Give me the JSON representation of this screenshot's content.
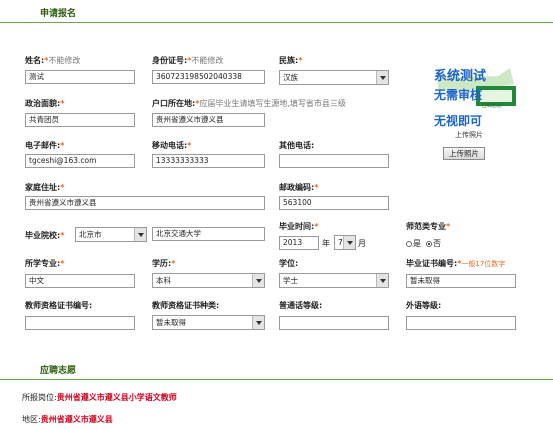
{
  "section1_title": "申请报名",
  "section2_title": "应聘志愿",
  "fields": {
    "name_label": "姓名:",
    "name_note": "不能修改",
    "name_value": "测试",
    "id_label": "身份证号:",
    "id_note": "不能修改",
    "id_value": "360723198502040338",
    "ethnic_label": "民族:",
    "ethnic_value": "汉族",
    "political_label": "政治面貌:",
    "political_value": "共青团员",
    "hukou_label": "户口所在地:",
    "hukou_note": "应届毕业生请填写生源地,填写省市县三级",
    "hukou_value": "贵州省遵义市遵义县",
    "email_label": "电子邮件:",
    "email_value": "tgceshi@163.com",
    "mobile_label": "移动电话:",
    "mobile_value": "13333333333",
    "other_phone_label": "其他电话:",
    "other_phone_value": "",
    "address_label": "家庭住址:",
    "address_value": "贵州省遵义市遵义县",
    "postcode_label": "邮政编码:",
    "postcode_value": "563100",
    "school_label": "毕业院校:",
    "school_city": "北京市",
    "school_value": "北京交通大学",
    "grad_time_label": "毕业时间:",
    "grad_year": "2013",
    "year_unit": "年",
    "grad_month": "7",
    "month_unit": "月",
    "normal_label": "师范类专业",
    "normal_yes": "是",
    "normal_no": "否",
    "major_label": "所学专业:",
    "major_value": "中文",
    "edu_label": "学历:",
    "edu_value": "本科",
    "degree_label": "学位:",
    "degree_value": "学士",
    "cert_no_label": "毕业证书编号:",
    "cert_no_note": "一般17位数字",
    "cert_no_value": "暂未取得",
    "teacher_cert_no_label": "教师资格证书编号:",
    "teacher_cert_no_value": "",
    "teacher_cert_type_label": "教师资格证书种类:",
    "teacher_cert_type_value": "暂未取得",
    "mandarin_label": "普通话等级:",
    "mandarin_value": "",
    "foreign_label": "外语等级:",
    "foreign_value": ""
  },
  "photo": {
    "line1": "系统测试",
    "line2": "无需审核",
    "line3": "应聘志愿",
    "line4": "无视即可",
    "caption": "上传照片",
    "button": "上传照片"
  },
  "application": {
    "position_label": "所报岗位:",
    "position_value": "贵州省遵义市遵义县小学语文教师",
    "area_label": "地区:",
    "area_value": "贵州省遵义市遵义县"
  },
  "colors": {
    "accent": "#6aa84f",
    "required": "#e86b1a",
    "highlight": "#d0021b"
  }
}
